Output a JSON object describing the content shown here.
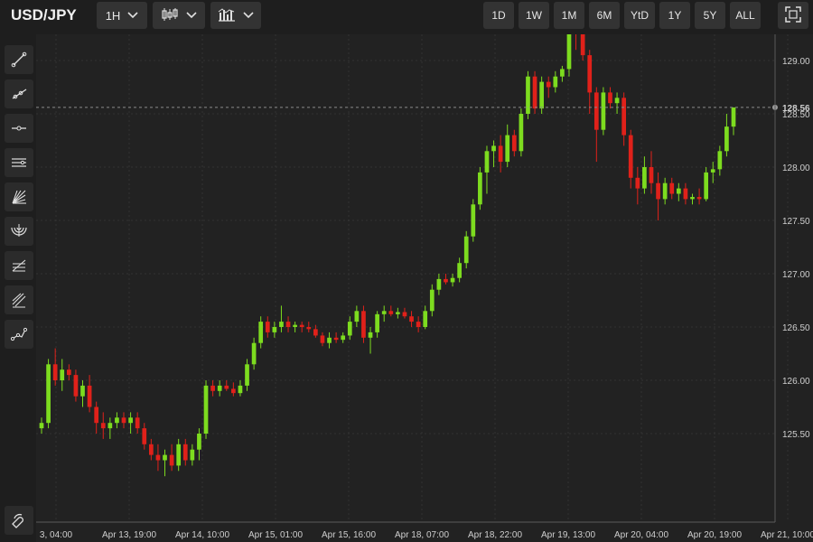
{
  "header": {
    "symbol": "USD/JPY",
    "interval": "1H",
    "ranges": [
      "1D",
      "1W",
      "1M",
      "6M",
      "YtD",
      "1Y",
      "5Y",
      "ALL"
    ]
  },
  "icons": {
    "chart_type": "candlestick-icon",
    "indicators": "bar-chart-icon",
    "fullscreen": "fullscreen-icon",
    "sidebar_tools": [
      "trend-line-icon",
      "ray-icon",
      "horizontal-line-icon",
      "parallel-channel-icon",
      "fib-fan-icon",
      "fib-arc-icon",
      "fib-retracement-icon",
      "pitchfork-icon",
      "path-icon"
    ],
    "magnet": "magnet-icon"
  },
  "colors": {
    "up": "#7ddc1f",
    "down": "#e0211a",
    "background": "#222222"
  },
  "chart_data": {
    "type": "candlestick",
    "symbol": "USD/JPY",
    "interval": "1H",
    "last_price": "128.56",
    "ylim": [
      125.0,
      129.5
    ],
    "yticks": [
      "125.50",
      "126.00",
      "126.50",
      "127.00",
      "127.50",
      "128.00",
      "128.50",
      "129.00"
    ],
    "xticks": [
      "3, 04:00",
      "Apr 13, 19:00",
      "Apr 14, 10:00",
      "Apr 15, 01:00",
      "Apr 15, 16:00",
      "Apr 18, 07:00",
      "Apr 18, 22:00",
      "Apr 19, 13:00",
      "Apr 20, 04:00",
      "Apr 20, 19:00",
      "Apr 21, 10:00"
    ],
    "candles": [
      [
        125.55,
        125.65,
        125.5,
        125.6
      ],
      [
        125.6,
        126.2,
        125.55,
        126.15
      ],
      [
        126.15,
        126.3,
        125.95,
        126.0
      ],
      [
        126.0,
        126.2,
        125.9,
        126.1
      ],
      [
        126.1,
        126.15,
        126.0,
        126.05
      ],
      [
        126.05,
        126.1,
        125.8,
        125.85
      ],
      [
        125.85,
        126.0,
        125.75,
        125.95
      ],
      [
        125.95,
        126.05,
        125.7,
        125.75
      ],
      [
        125.75,
        125.8,
        125.5,
        125.6
      ],
      [
        125.6,
        125.7,
        125.45,
        125.55
      ],
      [
        125.55,
        125.65,
        125.45,
        125.6
      ],
      [
        125.6,
        125.7,
        125.55,
        125.65
      ],
      [
        125.65,
        125.7,
        125.55,
        125.6
      ],
      [
        125.6,
        125.7,
        125.5,
        125.65
      ],
      [
        125.65,
        125.7,
        125.5,
        125.55
      ],
      [
        125.55,
        125.6,
        125.35,
        125.4
      ],
      [
        125.4,
        125.45,
        125.25,
        125.3
      ],
      [
        125.3,
        125.4,
        125.15,
        125.25
      ],
      [
        125.25,
        125.35,
        125.1,
        125.3
      ],
      [
        125.3,
        125.4,
        125.15,
        125.2
      ],
      [
        125.2,
        125.45,
        125.15,
        125.4
      ],
      [
        125.4,
        125.45,
        125.2,
        125.25
      ],
      [
        125.25,
        125.4,
        125.2,
        125.35
      ],
      [
        125.35,
        125.55,
        125.25,
        125.5
      ],
      [
        125.5,
        126.0,
        125.45,
        125.95
      ],
      [
        125.95,
        126.0,
        125.85,
        125.9
      ],
      [
        125.9,
        126.0,
        125.85,
        125.95
      ],
      [
        125.95,
        126.0,
        125.9,
        125.92
      ],
      [
        125.92,
        125.98,
        125.85,
        125.88
      ],
      [
        125.88,
        126.0,
        125.85,
        125.95
      ],
      [
        125.95,
        126.2,
        125.9,
        126.15
      ],
      [
        126.15,
        126.4,
        126.1,
        126.35
      ],
      [
        126.35,
        126.6,
        126.3,
        126.55
      ],
      [
        126.55,
        126.6,
        126.4,
        126.45
      ],
      [
        126.45,
        126.55,
        126.4,
        126.5
      ],
      [
        126.5,
        126.7,
        126.45,
        126.55
      ],
      [
        126.55,
        126.6,
        126.45,
        126.5
      ],
      [
        126.5,
        126.55,
        126.45,
        126.52
      ],
      [
        126.52,
        126.55,
        126.45,
        126.5
      ],
      [
        126.5,
        126.55,
        126.45,
        126.48
      ],
      [
        126.48,
        126.52,
        126.4,
        126.42
      ],
      [
        126.42,
        126.45,
        126.32,
        126.35
      ],
      [
        126.35,
        126.45,
        126.3,
        126.4
      ],
      [
        126.4,
        126.45,
        126.35,
        126.38
      ],
      [
        126.38,
        126.45,
        126.35,
        126.42
      ],
      [
        126.42,
        126.6,
        126.38,
        126.55
      ],
      [
        126.55,
        126.7,
        126.5,
        126.65
      ],
      [
        126.65,
        126.7,
        126.35,
        126.4
      ],
      [
        126.4,
        126.5,
        126.25,
        126.45
      ],
      [
        126.45,
        126.65,
        126.4,
        126.62
      ],
      [
        126.62,
        126.7,
        126.55,
        126.65
      ],
      [
        126.65,
        126.7,
        126.6,
        126.62
      ],
      [
        126.62,
        126.68,
        126.58,
        126.64
      ],
      [
        126.64,
        126.68,
        126.58,
        126.6
      ],
      [
        126.6,
        126.65,
        126.5,
        126.55
      ],
      [
        126.55,
        126.6,
        126.45,
        126.5
      ],
      [
        126.5,
        126.7,
        126.48,
        126.65
      ],
      [
        126.65,
        126.9,
        126.6,
        126.85
      ],
      [
        126.85,
        127.0,
        126.8,
        126.95
      ],
      [
        126.95,
        127.0,
        126.9,
        126.92
      ],
      [
        126.92,
        127.0,
        126.88,
        126.96
      ],
      [
        126.96,
        127.15,
        126.92,
        127.1
      ],
      [
        127.1,
        127.4,
        127.05,
        127.35
      ],
      [
        127.35,
        127.7,
        127.3,
        127.65
      ],
      [
        127.65,
        128.0,
        127.6,
        127.95
      ],
      [
        127.95,
        128.2,
        127.75,
        128.15
      ],
      [
        128.15,
        128.25,
        128.0,
        128.2
      ],
      [
        128.2,
        128.3,
        127.95,
        128.05
      ],
      [
        128.05,
        128.4,
        128.0,
        128.3
      ],
      [
        128.3,
        128.35,
        128.1,
        128.15
      ],
      [
        128.15,
        128.55,
        128.1,
        128.5
      ],
      [
        128.5,
        128.9,
        128.45,
        128.85
      ],
      [
        128.85,
        128.9,
        128.5,
        128.55
      ],
      [
        128.55,
        128.85,
        128.5,
        128.8
      ],
      [
        128.8,
        128.85,
        128.65,
        128.75
      ],
      [
        128.75,
        128.9,
        128.7,
        128.85
      ],
      [
        128.85,
        128.95,
        128.8,
        128.92
      ],
      [
        128.92,
        129.4,
        128.85,
        129.3
      ],
      [
        129.3,
        129.35,
        129.1,
        129.25
      ],
      [
        129.25,
        129.3,
        129.0,
        129.05
      ],
      [
        129.05,
        129.1,
        128.5,
        128.7
      ],
      [
        128.7,
        128.75,
        128.05,
        128.35
      ],
      [
        128.35,
        128.75,
        128.3,
        128.7
      ],
      [
        128.7,
        128.75,
        128.55,
        128.6
      ],
      [
        128.6,
        128.7,
        128.5,
        128.65
      ],
      [
        128.65,
        128.7,
        128.2,
        128.3
      ],
      [
        128.3,
        128.35,
        127.8,
        127.9
      ],
      [
        127.9,
        128.0,
        127.65,
        127.8
      ],
      [
        127.8,
        128.1,
        127.75,
        128.0
      ],
      [
        128.0,
        128.15,
        127.75,
        127.85
      ],
      [
        127.85,
        127.95,
        127.5,
        127.7
      ],
      [
        127.7,
        127.9,
        127.65,
        127.85
      ],
      [
        127.85,
        127.9,
        127.7,
        127.75
      ],
      [
        127.75,
        127.85,
        127.68,
        127.8
      ],
      [
        127.8,
        127.85,
        127.65,
        127.7
      ],
      [
        127.7,
        127.75,
        127.65,
        127.72
      ],
      [
        127.72,
        127.8,
        127.65,
        127.7
      ],
      [
        127.7,
        128.0,
        127.68,
        127.95
      ],
      [
        127.95,
        128.05,
        127.85,
        127.98
      ],
      [
        127.98,
        128.2,
        127.92,
        128.15
      ],
      [
        128.15,
        128.5,
        128.1,
        128.38
      ],
      [
        128.38,
        128.56,
        128.3,
        128.56
      ]
    ]
  }
}
